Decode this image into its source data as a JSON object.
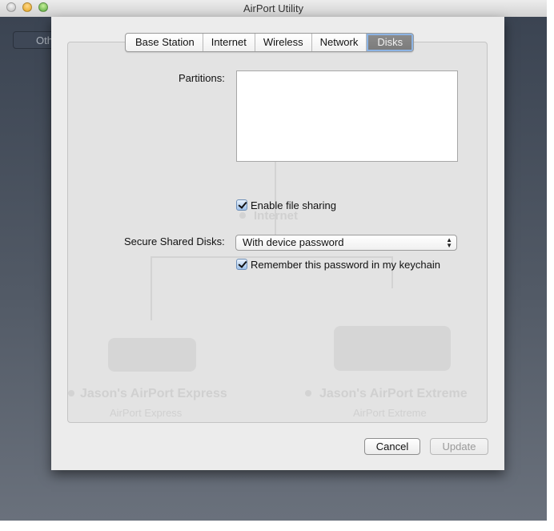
{
  "window": {
    "title": "AirPort Utility"
  },
  "background": {
    "other_button_label": "Oth",
    "diagram": {
      "internet_label": "Internet",
      "devices": [
        {
          "name": "Jason's AirPort Express",
          "subtitle": "AirPort Express"
        },
        {
          "name": "Jason's AirPort Extreme",
          "subtitle": "AirPort Extreme"
        }
      ]
    }
  },
  "tabs": [
    {
      "label": "Base Station",
      "active": false
    },
    {
      "label": "Internet",
      "active": false
    },
    {
      "label": "Wireless",
      "active": false
    },
    {
      "label": "Network",
      "active": false
    },
    {
      "label": "Disks",
      "active": true
    }
  ],
  "disks": {
    "partitions_label": "Partitions:",
    "partitions": [],
    "enable_file_sharing": {
      "label": "Enable file sharing",
      "checked": true
    },
    "secure_shared_disks": {
      "label": "Secure Shared Disks:",
      "selected": "With device password"
    },
    "remember_password": {
      "label": "Remember this password in my keychain",
      "checked": true
    }
  },
  "buttons": {
    "cancel": "Cancel",
    "update": {
      "label": "Update",
      "enabled": false
    }
  }
}
